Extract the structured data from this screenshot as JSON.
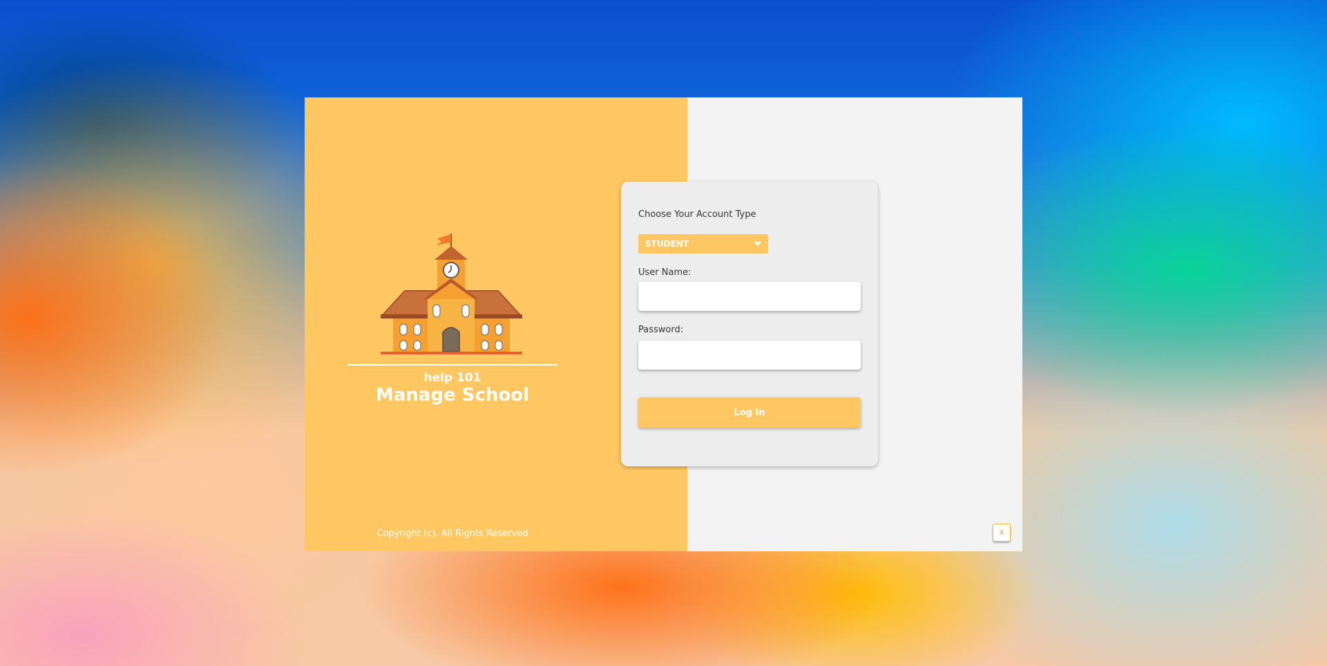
{
  "brand": {
    "subtitle": "help 101",
    "title": "Manage School",
    "copyright": "Copyright (c). All Rights Reserved",
    "illustration": "school-building-icon"
  },
  "login": {
    "account_type_label": "Choose Your Account Type",
    "account_type_value": "STUDENT",
    "username_label": "User Name:",
    "username_value": "",
    "password_label": "Password:",
    "password_value": "",
    "login_button_label": "Log In"
  },
  "window": {
    "close_label": "x"
  },
  "colors": {
    "accent": "#fec762",
    "panel_background": "#f3f3f3",
    "card_background": "#ededed",
    "text": "#333333"
  }
}
